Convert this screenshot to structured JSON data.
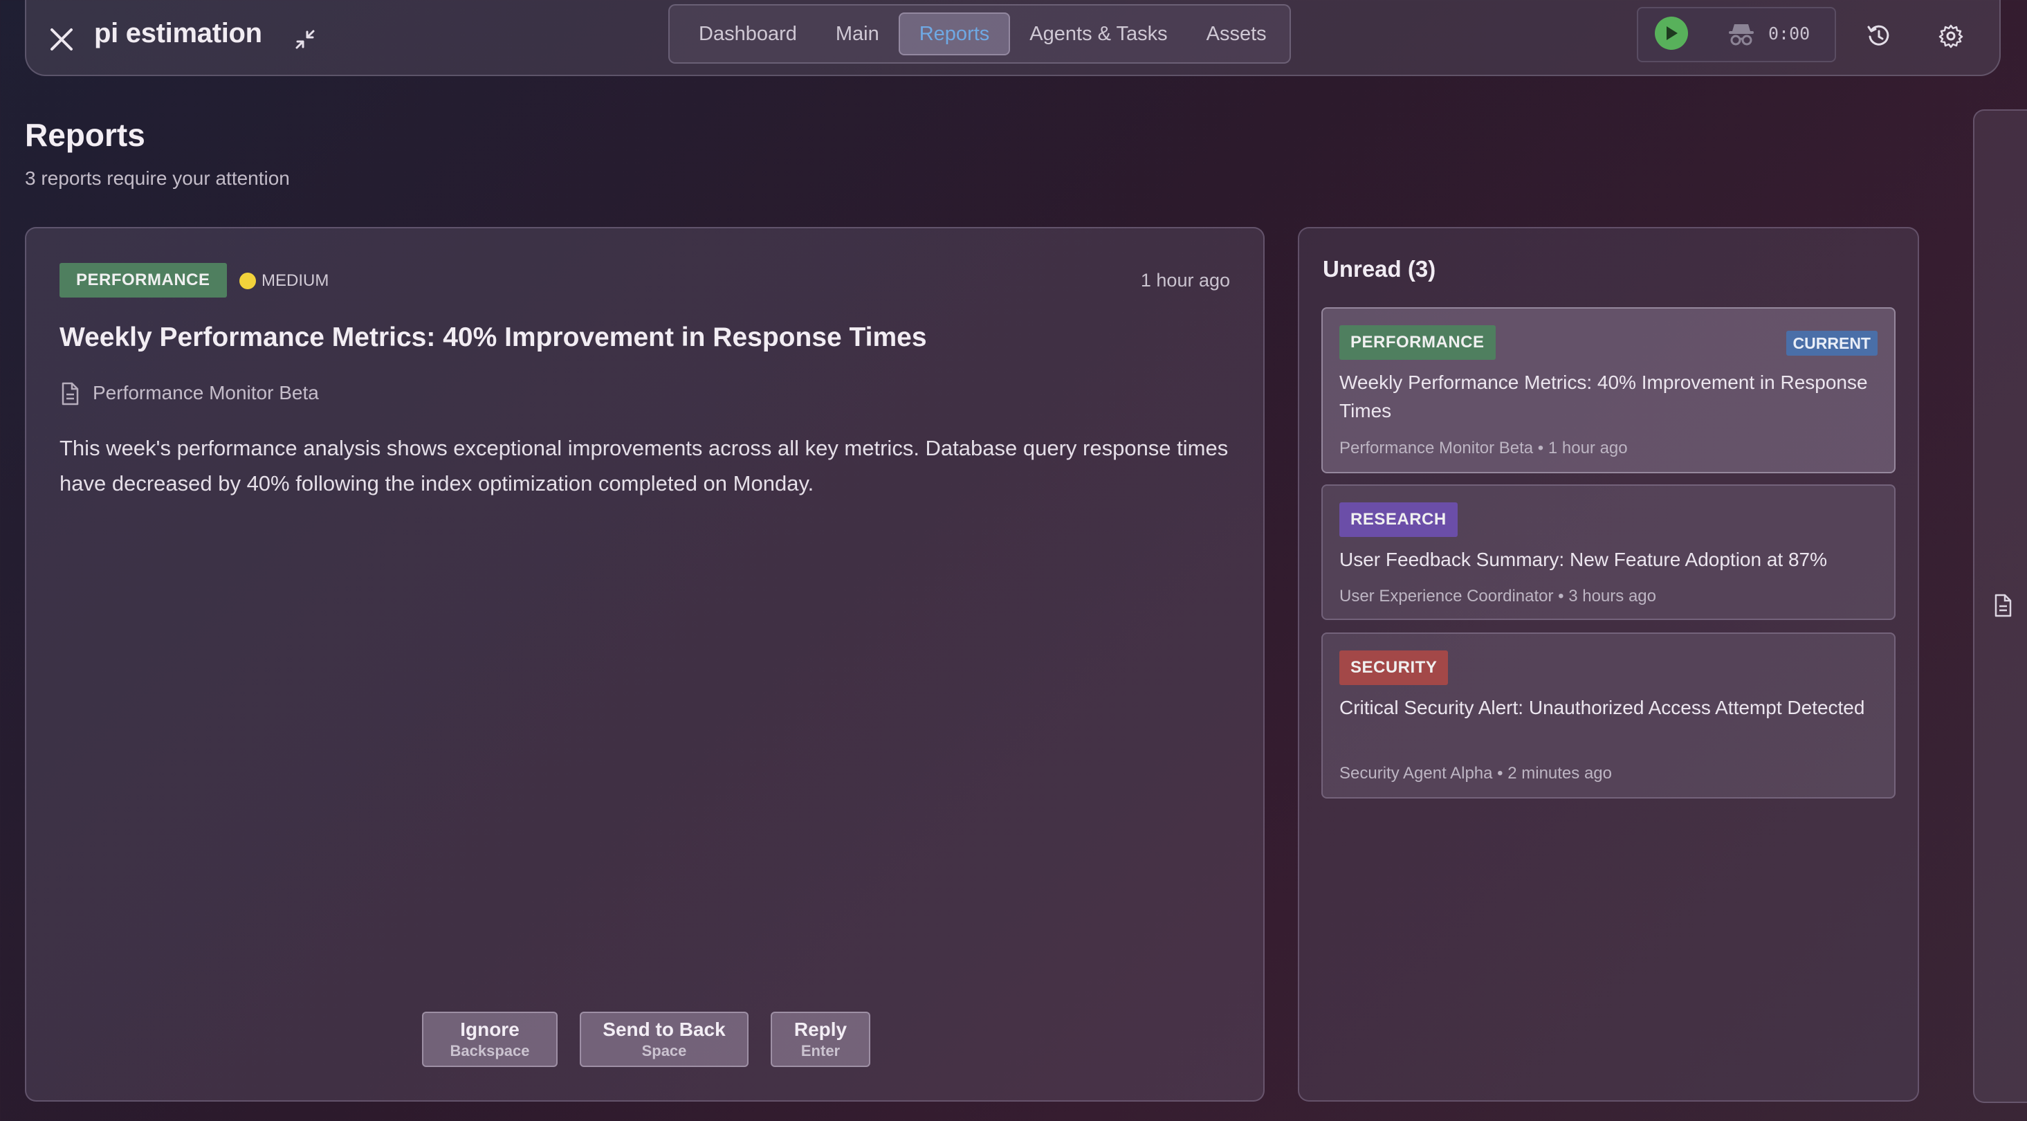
{
  "app": {
    "title": "pi estimation"
  },
  "nav": {
    "tabs": [
      {
        "label": "Dashboard"
      },
      {
        "label": "Main"
      },
      {
        "label": "Reports"
      },
      {
        "label": "Agents & Tasks"
      },
      {
        "label": "Assets"
      }
    ],
    "active_tab": "Reports"
  },
  "runner": {
    "timer": "0:00"
  },
  "page": {
    "title": "Reports",
    "subtitle": "3 reports require your attention"
  },
  "report": {
    "category": "PERFORMANCE",
    "priority": "MEDIUM",
    "time": "1 hour ago",
    "title": "Weekly Performance Metrics: 40% Improvement in Response Times",
    "author": "Performance Monitor Beta",
    "body": "This week's performance analysis shows exceptional improvements across all key metrics. Database query response times have decreased by 40% following the index optimization completed on Monday."
  },
  "actions": {
    "ignore": {
      "label": "Ignore",
      "key": "Backspace"
    },
    "send_back": {
      "label": "Send to Back",
      "key": "Space"
    },
    "reply": {
      "label": "Reply",
      "key": "Enter"
    }
  },
  "unread": {
    "title": "Unread (3)",
    "current_badge": "CURRENT",
    "items": [
      {
        "category": "PERFORMANCE",
        "title": "Weekly Performance Metrics: 40% Improvement in Response Times",
        "meta": "Performance Monitor Beta • 1 hour ago"
      },
      {
        "category": "RESEARCH",
        "title": "User Feedback Summary: New Feature Adoption at 87%",
        "meta": "User Experience Coordinator • 3 hours ago"
      },
      {
        "category": "SECURITY",
        "title": "Critical Security Alert: Unauthorized Access Attempt Detected",
        "meta": "Security Agent Alpha • 2 minutes ago"
      }
    ]
  },
  "colors": {
    "performance": "#4f7f5f",
    "research": "#6b4ea8",
    "security": "#a34848",
    "current": "#4a6fa8",
    "active_tab_text": "#6fa9e4",
    "play": "#58b15b",
    "priority_medium": "#f2d23b"
  },
  "icons": {
    "close": "close-icon",
    "collapse": "collapse-icon",
    "play": "play-icon",
    "incognito": "incognito-icon",
    "history": "history-icon",
    "settings": "gear-icon",
    "document": "document-icon"
  }
}
